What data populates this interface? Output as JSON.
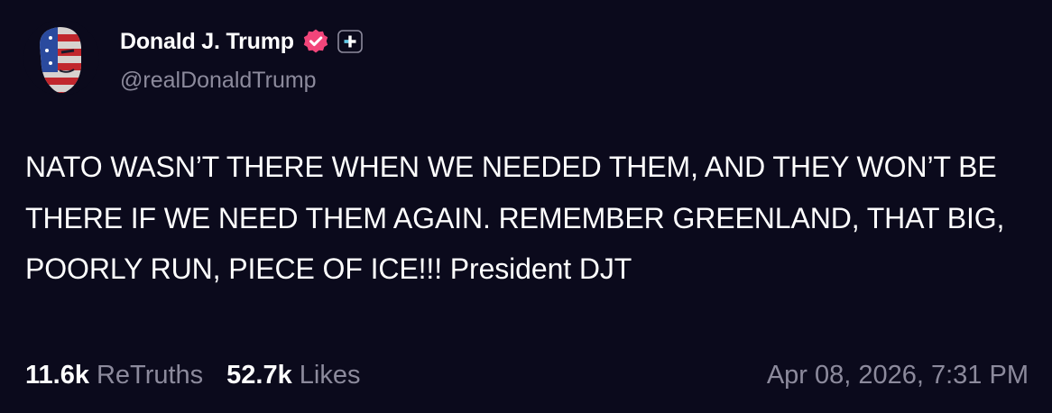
{
  "author": {
    "display_name": "Donald J. Trump",
    "handle": "@realDonaldTrump",
    "verified_icon": "verified-check-icon",
    "badge_icon": "plus-badge-icon"
  },
  "post": {
    "text": "NATO WASN’T THERE WHEN WE NEEDED THEM, AND THEY WON’T BE THERE IF WE NEED THEM AGAIN. REMEMBER GREENLAND, THAT BIG, POORLY RUN, PIECE OF ICE!!! President DJT",
    "retruths_count": "11.6k",
    "retruths_label": "ReTruths",
    "likes_count": "52.7k",
    "likes_label": "Likes",
    "timestamp": "Apr 08, 2026, 7:31 PM"
  },
  "colors": {
    "background": "#0b0a1c",
    "text_primary": "#ffffff",
    "text_secondary": "#8c8a9c",
    "verified_badge": "#f2457a"
  }
}
